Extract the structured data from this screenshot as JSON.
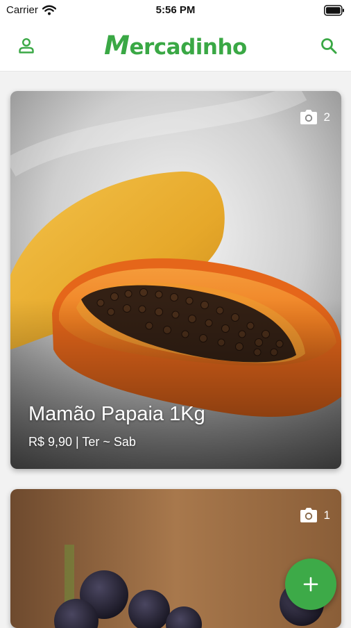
{
  "status_bar": {
    "carrier": "Carrier",
    "time": "5:56 PM",
    "icons": [
      "wifi-icon",
      "battery-icon"
    ]
  },
  "header": {
    "brand_initial": "M",
    "brand_rest": "ercadinho",
    "icons": [
      "user-icon",
      "search-icon"
    ],
    "accent_color": "#3aa845"
  },
  "products": [
    {
      "title": "Mamão Papaia 1Kg",
      "subtitle": "R$ 9,90 | Ter ~ Sab",
      "photo_count": "2"
    },
    {
      "title": "",
      "subtitle": "",
      "photo_count": "1"
    }
  ],
  "fab": {
    "label": "+",
    "color": "#3daa48"
  }
}
